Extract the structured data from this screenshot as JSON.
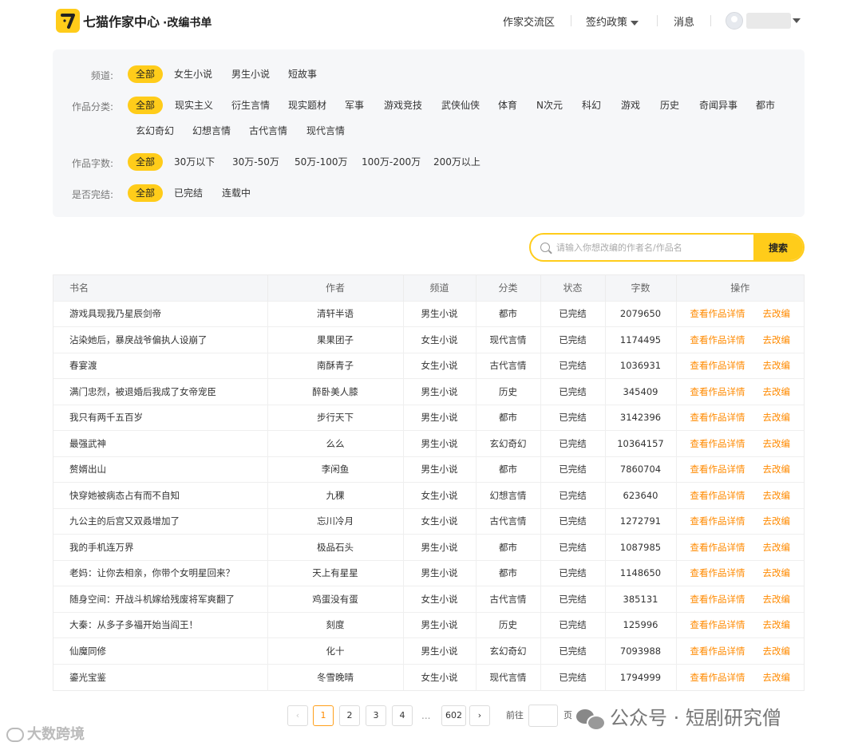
{
  "header": {
    "brand": "七猫作家中心",
    "brand_sub": "·改编书单",
    "nav": {
      "community": "作家交流区",
      "contract_policy": "签约政策",
      "messages": "消息"
    }
  },
  "filters": {
    "channel": {
      "label": "频道:",
      "options": [
        "全部",
        "女生小说",
        "男生小说",
        "短故事"
      ],
      "selected": "全部"
    },
    "category": {
      "label": "作品分类:",
      "options": [
        "全部",
        "现实主义",
        "衍生言情",
        "现实题材",
        "军事",
        "游戏竞技",
        "武侠仙侠",
        "体育",
        "N次元",
        "科幻",
        "游戏",
        "历史",
        "奇闻异事",
        "都市",
        "玄幻奇幻",
        "幻想言情",
        "古代言情",
        "现代言情"
      ],
      "selected": "全部"
    },
    "word_count": {
      "label": "作品字数:",
      "options": [
        "全部",
        "30万以下",
        "30万-50万",
        "50万-100万",
        "100万-200万",
        "200万以上"
      ],
      "selected": "全部"
    },
    "completed": {
      "label": "是否完结:",
      "options": [
        "全部",
        "已完结",
        "连载中"
      ],
      "selected": "全部"
    }
  },
  "search": {
    "placeholder": "请输入你想改编的作者名/作品名",
    "button": "搜索"
  },
  "table": {
    "headers": [
      "书名",
      "作者",
      "频道",
      "分类",
      "状态",
      "字数",
      "操作"
    ],
    "action_detail": "查看作品详情",
    "action_adapt": "去改编",
    "rows": [
      [
        "游戏具现我乃星辰剑帝",
        "清轩半语",
        "男生小说",
        "都市",
        "已完结",
        "2079650"
      ],
      [
        "沾染她后，暴戾战爷偏执人设崩了",
        "果果团子",
        "女生小说",
        "现代言情",
        "已完结",
        "1174495"
      ],
      [
        "春宴渡",
        "南酥青子",
        "女生小说",
        "古代言情",
        "已完结",
        "1036931"
      ],
      [
        "满门忠烈，被退婚后我成了女帝宠臣",
        "醉卧美人膝",
        "男生小说",
        "历史",
        "已完结",
        "345409"
      ],
      [
        "我只有两千五百岁",
        "步行天下",
        "男生小说",
        "都市",
        "已完结",
        "3142396"
      ],
      [
        "最强武神",
        "么么",
        "男生小说",
        "玄幻奇幻",
        "已完结",
        "10364157"
      ],
      [
        "赘婿出山",
        "李闲鱼",
        "男生小说",
        "都市",
        "已完结",
        "7860704"
      ],
      [
        "快穿她被病态占有而不自知",
        "九稞",
        "女生小说",
        "幻想言情",
        "已完结",
        "623640"
      ],
      [
        "九公主的后宫又双叒增加了",
        "忘川冷月",
        "女生小说",
        "古代言情",
        "已完结",
        "1272791"
      ],
      [
        "我的手机连万界",
        "极品石头",
        "男生小说",
        "都市",
        "已完结",
        "1087985"
      ],
      [
        "老妈：让你去相亲，你带个女明星回来？",
        "天上有星星",
        "男生小说",
        "都市",
        "已完结",
        "1148650"
      ],
      [
        "随身空间：开战斗机嫁给残废将军爽翻了",
        "鸡蛋没有蛋",
        "女生小说",
        "古代言情",
        "已完结",
        "385131"
      ],
      [
        "大秦：从多子多福开始当阎王！",
        "刻度",
        "男生小说",
        "历史",
        "已完结",
        "125996"
      ],
      [
        "仙魔同修",
        "化十",
        "男生小说",
        "玄幻奇幻",
        "已完结",
        "7093988"
      ],
      [
        "鎏光宝鉴",
        "冬雪晚晴",
        "女生小说",
        "现代言情",
        "已完结",
        "1794999"
      ]
    ]
  },
  "pagination": {
    "prev": "‹",
    "pages": [
      "1",
      "2",
      "3",
      "4"
    ],
    "current": "1",
    "ellipsis": "...",
    "last": "602",
    "next": "›",
    "goto_prefix": "前往",
    "goto_suffix": "页"
  },
  "watermarks": {
    "left": "大数跨境",
    "right": "公众号 · 短剧研究僧"
  }
}
